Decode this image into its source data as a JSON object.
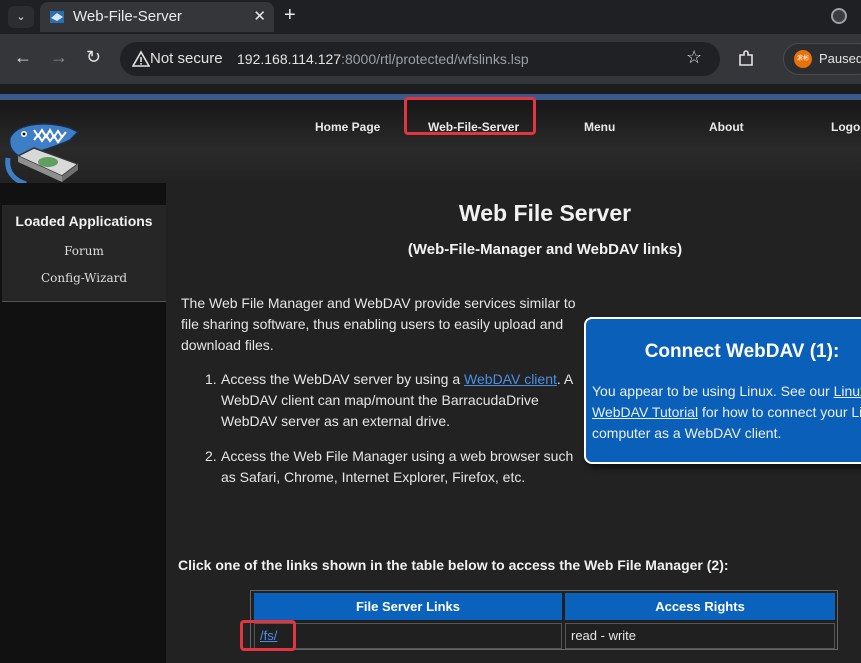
{
  "browser": {
    "tab_title": "Web-File-Server",
    "tab_menu_icon": "chevron-down-icon",
    "security_label": "Not secure",
    "url_host": "192.168.114.127",
    "url_rest": ":8000/rtl/protected/wfslinks.lsp",
    "profile_label": "Paused",
    "profile_avatar_text": "滚彬"
  },
  "site": {
    "menu": [
      "Home Page",
      "Web-File-Server",
      "Menu",
      "About",
      "Logout"
    ],
    "sidebar": {
      "title": "Loaded Applications",
      "links": [
        "Forum",
        "Config-Wizard"
      ]
    }
  },
  "main": {
    "title": "Web File Server",
    "subtitle": "(Web-File-Manager and WebDAV links)",
    "intro": "The Web File Manager and WebDAV provide services similar to file sharing software, thus enabling users to easily upload and download files.",
    "list": [
      {
        "num": "1.",
        "before": "Access the WebDAV server by using a ",
        "link": "WebDAV client",
        "after": ". A WebDAV client can map/mount the BarracudaDrive WebDAV server as an external drive."
      },
      {
        "num": "2.",
        "text": "Access the Web File Manager using a web browser such as Safari, Chrome, Internet Explorer, Firefox, etc."
      }
    ],
    "webdav_box": {
      "title": "Connect WebDAV (1):",
      "text_before": "You appear to be using Linux. See our ",
      "link": "Linux WebDAV Tutorial",
      "text_after": " for how to connect your Linux computer as a WebDAV client."
    },
    "click_text": "Click one of the links shown in the table below to access the Web File Manager (2):",
    "table": {
      "headers": [
        "File Server Links",
        "Access Rights"
      ],
      "rows": [
        {
          "link": "/fs/",
          "rights": "read - write"
        }
      ]
    }
  },
  "colors": {
    "highlight": "#e2353f",
    "accent_blue": "#0b62bd"
  }
}
